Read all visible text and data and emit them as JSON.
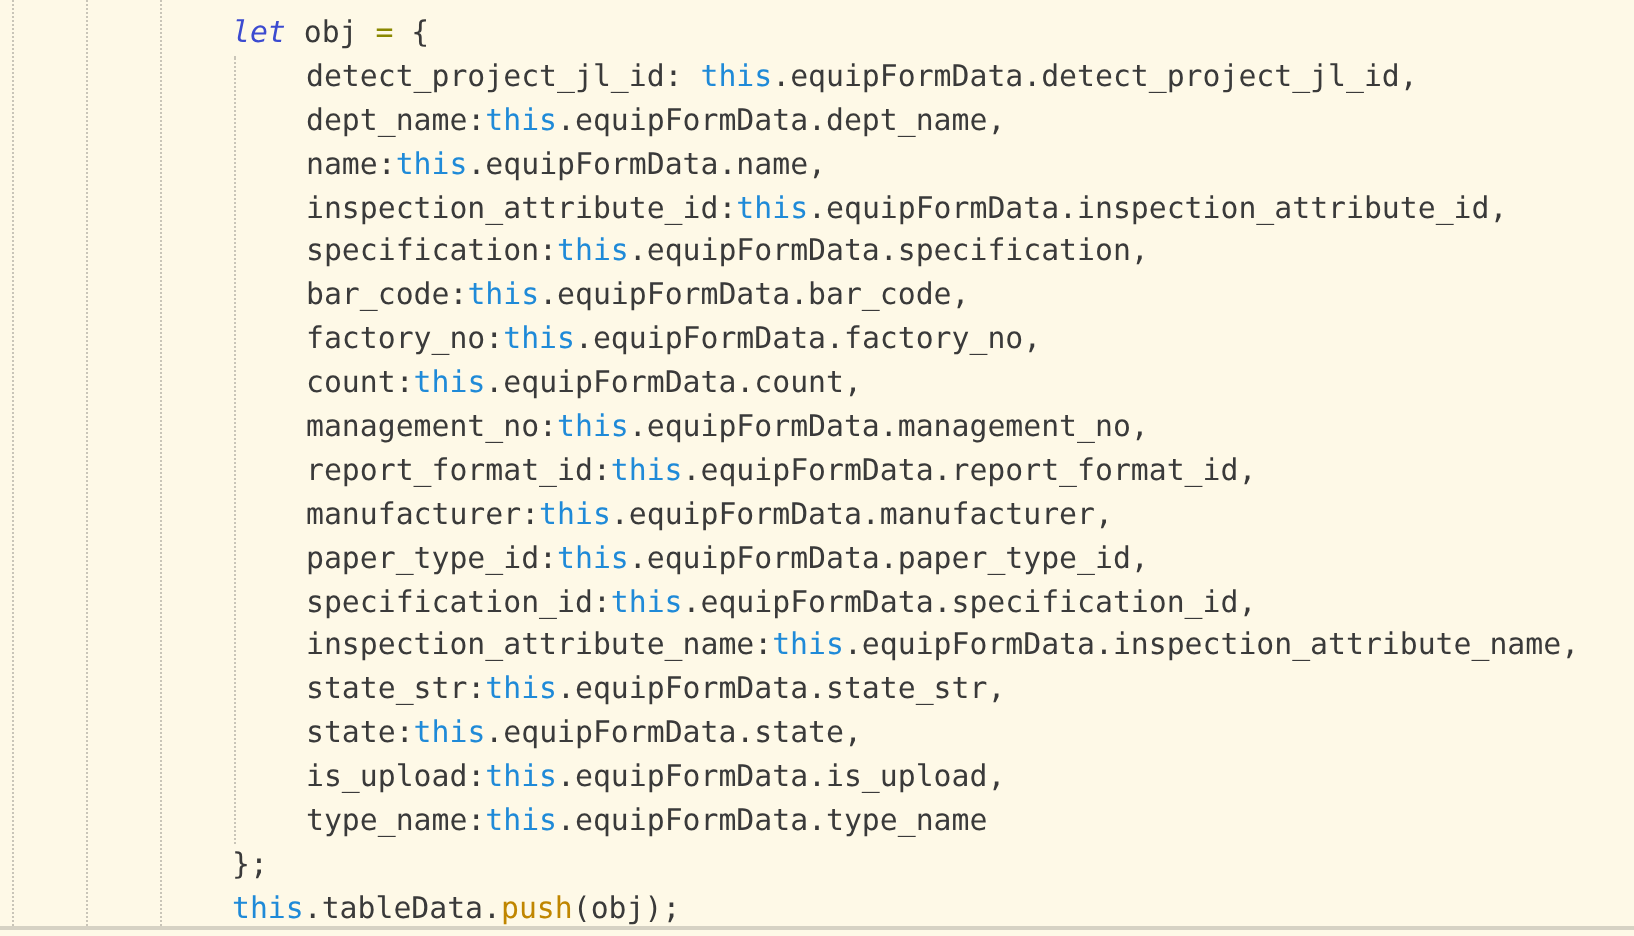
{
  "code": [
    {
      "tokens": [
        {
          "kind": "keyword",
          "text": "let"
        },
        {
          "kind": "plain",
          "text": " obj "
        },
        {
          "kind": "operator",
          "text": "="
        },
        {
          "kind": "plain",
          "text": " {"
        }
      ],
      "children": [
        {
          "tokens": [
            {
              "kind": "plain",
              "text": "detect_project_jl_id: "
            },
            {
              "kind": "this",
              "text": "this"
            },
            {
              "kind": "plain",
              "text": ".equipFormData.detect_project_jl_id,"
            }
          ]
        },
        {
          "tokens": [
            {
              "kind": "plain",
              "text": "dept_name:"
            },
            {
              "kind": "this",
              "text": "this"
            },
            {
              "kind": "plain",
              "text": ".equipFormData.dept_name,"
            }
          ]
        },
        {
          "tokens": [
            {
              "kind": "plain",
              "text": "name:"
            },
            {
              "kind": "this",
              "text": "this"
            },
            {
              "kind": "plain",
              "text": ".equipFormData.name,"
            }
          ]
        },
        {
          "tokens": [
            {
              "kind": "plain",
              "text": "inspection_attribute_id:"
            },
            {
              "kind": "this",
              "text": "this"
            },
            {
              "kind": "plain",
              "text": ".equipFormData.inspection_attribute_id,"
            }
          ]
        },
        {
          "tokens": [
            {
              "kind": "plain",
              "text": "specification:"
            },
            {
              "kind": "this",
              "text": "this"
            },
            {
              "kind": "plain",
              "text": ".equipFormData.specification,"
            }
          ]
        },
        {
          "tokens": [
            {
              "kind": "plain",
              "text": "bar_code:"
            },
            {
              "kind": "this",
              "text": "this"
            },
            {
              "kind": "plain",
              "text": ".equipFormData.bar_code,"
            }
          ]
        },
        {
          "tokens": [
            {
              "kind": "plain",
              "text": "factory_no:"
            },
            {
              "kind": "this",
              "text": "this"
            },
            {
              "kind": "plain",
              "text": ".equipFormData.factory_no,"
            }
          ]
        },
        {
          "tokens": [
            {
              "kind": "plain",
              "text": "count:"
            },
            {
              "kind": "this",
              "text": "this"
            },
            {
              "kind": "plain",
              "text": ".equipFormData.count,"
            }
          ]
        },
        {
          "tokens": [
            {
              "kind": "plain",
              "text": "management_no:"
            },
            {
              "kind": "this",
              "text": "this"
            },
            {
              "kind": "plain",
              "text": ".equipFormData.management_no,"
            }
          ]
        },
        {
          "tokens": [
            {
              "kind": "plain",
              "text": "report_format_id:"
            },
            {
              "kind": "this",
              "text": "this"
            },
            {
              "kind": "plain",
              "text": ".equipFormData.report_format_id,"
            }
          ]
        },
        {
          "tokens": [
            {
              "kind": "plain",
              "text": "manufacturer:"
            },
            {
              "kind": "this",
              "text": "this"
            },
            {
              "kind": "plain",
              "text": ".equipFormData.manufacturer,"
            }
          ]
        },
        {
          "tokens": [
            {
              "kind": "plain",
              "text": "paper_type_id:"
            },
            {
              "kind": "this",
              "text": "this"
            },
            {
              "kind": "plain",
              "text": ".equipFormData.paper_type_id,"
            }
          ]
        },
        {
          "tokens": [
            {
              "kind": "plain",
              "text": "specification_id:"
            },
            {
              "kind": "this",
              "text": "this"
            },
            {
              "kind": "plain",
              "text": ".equipFormData.specification_id,"
            }
          ]
        },
        {
          "tokens": [
            {
              "kind": "plain",
              "text": "inspection_attribute_name:"
            },
            {
              "kind": "this",
              "text": "this"
            },
            {
              "kind": "plain",
              "text": ".equipFormData.inspection_attribute_name,"
            }
          ]
        },
        {
          "tokens": [
            {
              "kind": "plain",
              "text": "state_str:"
            },
            {
              "kind": "this",
              "text": "this"
            },
            {
              "kind": "plain",
              "text": ".equipFormData.state_str,"
            }
          ]
        },
        {
          "tokens": [
            {
              "kind": "plain",
              "text": "state:"
            },
            {
              "kind": "this",
              "text": "this"
            },
            {
              "kind": "plain",
              "text": ".equipFormData.state,"
            }
          ]
        },
        {
          "tokens": [
            {
              "kind": "plain",
              "text": "is_upload:"
            },
            {
              "kind": "this",
              "text": "this"
            },
            {
              "kind": "plain",
              "text": ".equipFormData.is_upload,"
            }
          ]
        },
        {
          "tokens": [
            {
              "kind": "plain",
              "text": "type_name:"
            },
            {
              "kind": "this",
              "text": "this"
            },
            {
              "kind": "plain",
              "text": ".equipFormData.type_name"
            }
          ]
        }
      ]
    },
    {
      "tokens": [
        {
          "kind": "plain",
          "text": "};"
        }
      ]
    },
    {
      "tokens": [
        {
          "kind": "this",
          "text": "this"
        },
        {
          "kind": "plain",
          "text": ".tableData."
        },
        {
          "kind": "method",
          "text": "push"
        },
        {
          "kind": "plain",
          "text": "(obj);"
        }
      ]
    }
  ]
}
